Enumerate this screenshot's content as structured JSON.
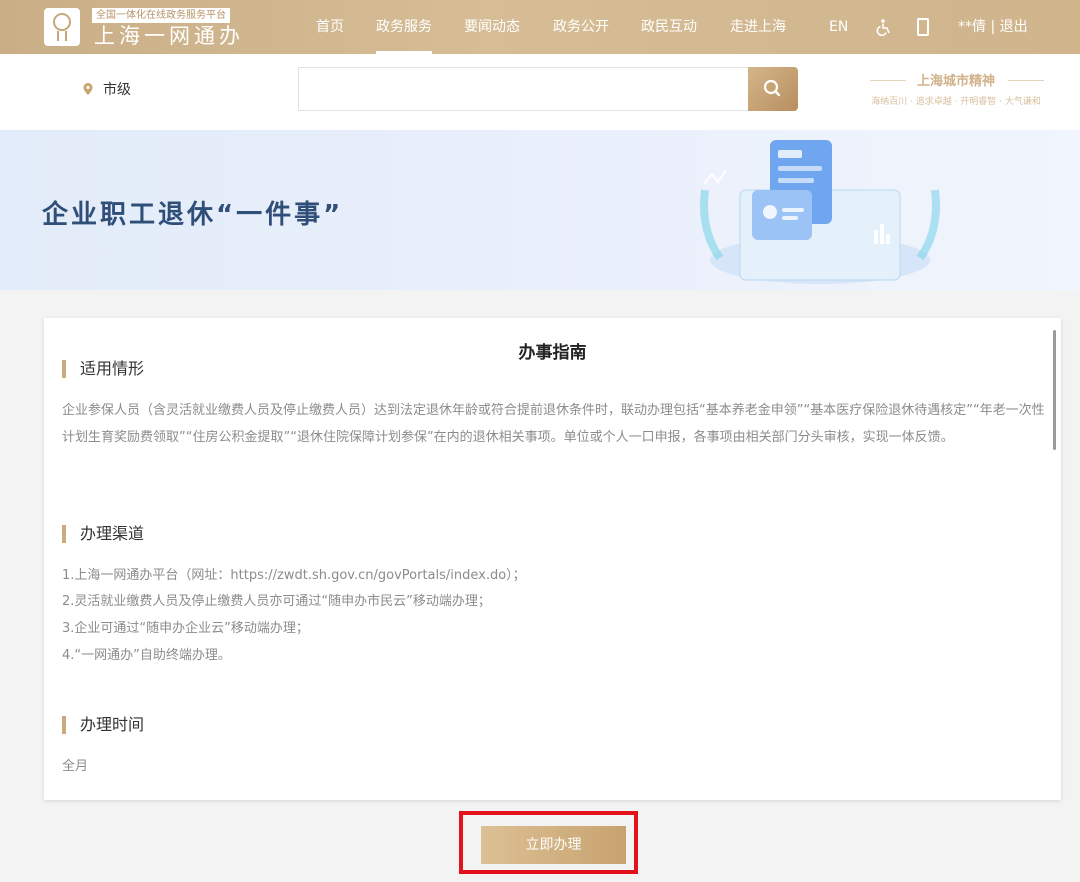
{
  "header": {
    "brand_sub": "全国一体化在线政务服务平台",
    "brand_main": "上海一网通办",
    "nav": [
      "首页",
      "政务服务",
      "要闻动态",
      "政务公开",
      "政民互动",
      "走进上海"
    ],
    "active_nav": "政务服务",
    "lang": "EN",
    "user": "**倩 | 退出"
  },
  "search": {
    "city": "市级",
    "placeholder": "",
    "spirit_title": "上海城市精神",
    "spirit_sub": "海纳百川 · 追求卓越 · 开明睿智 · 大气谦和"
  },
  "banner": {
    "title": "企业职工退休“一件事”"
  },
  "guide": {
    "title": "办事指南",
    "sections": [
      {
        "heading": "适用情形",
        "text": "企业参保人员（含灵活就业缴费人员及停止缴费人员）达到法定退休年龄或符合提前退休条件时，联动办理包括“基本养老金申领”“基本医疗保险退休待遇核定”“年老一次性计划生育奖励费领取”“住房公积金提取”“退休住院保障计划参保”在内的退休相关事项。单位或个人一口申报，各事项由相关部门分头审核，实现一体反馈。"
      },
      {
        "heading": "办理渠道",
        "lines": [
          "1.上海一网通办平台（网址：https://zwdt.sh.gov.cn/govPortals/index.do）；",
          "2.灵活就业缴费人员及停止缴费人员亦可通过“随申办市民云”移动端办理；",
          "3.企业可通过“随申办企业云”移动端办理；",
          "4.“一网通办”自助终端办理。"
        ]
      },
      {
        "heading": "办理时间",
        "text": "全月"
      }
    ]
  },
  "action": {
    "label": "立即办理"
  },
  "colors": {
    "gold": "#c9ae86",
    "banner_title": "#2f4f78",
    "highlight": "#e3121b"
  }
}
